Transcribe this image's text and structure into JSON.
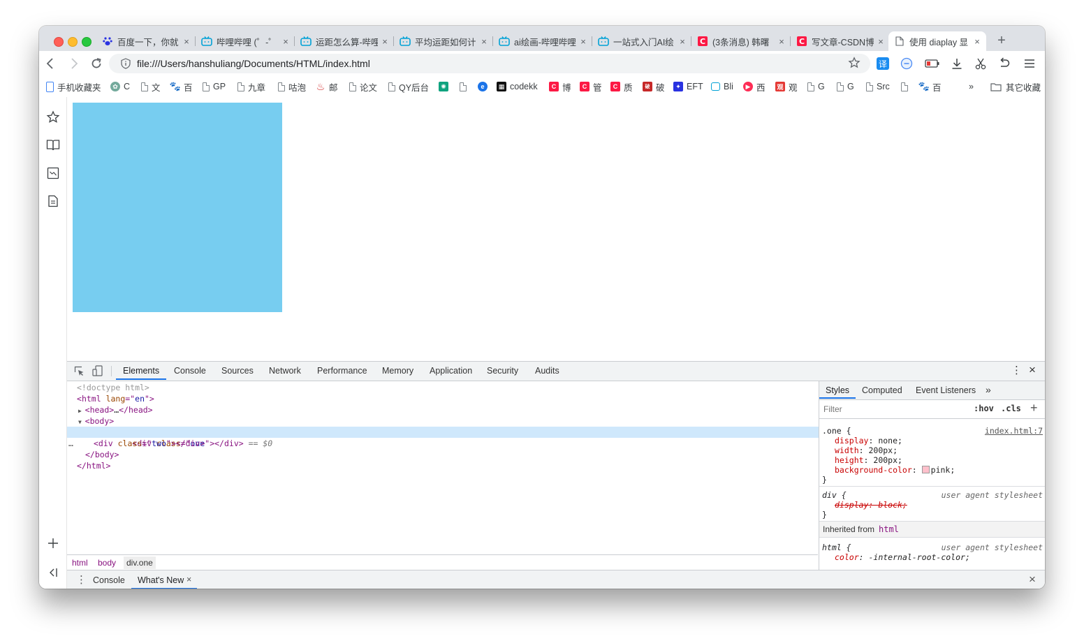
{
  "browser": {
    "tabs": [
      {
        "title": "百度一下，你就",
        "favicon": "baidu-paw",
        "active": false
      },
      {
        "title": "哔哩哔哩 (゜-゜",
        "favicon": "bilibili-tv",
        "active": false
      },
      {
        "title": "运距怎么算-哔哩",
        "favicon": "bilibili-tv",
        "active": false
      },
      {
        "title": "平均运距如何计",
        "favicon": "bilibili-tv",
        "active": false
      },
      {
        "title": "ai绘画-哔哩哔哩",
        "favicon": "bilibili-tv",
        "active": false
      },
      {
        "title": "一站式入门AI绘",
        "favicon": "bilibili-tv",
        "active": false
      },
      {
        "title": "(3条消息) 韩曙",
        "favicon": "csdn-c",
        "active": false
      },
      {
        "title": "写文章-CSDN博",
        "favicon": "csdn-c",
        "active": false
      },
      {
        "title": "使用 diaplay 显",
        "favicon": "file-page",
        "active": true
      }
    ],
    "close_glyph": "×",
    "new_tab_glyph": "+",
    "url": "file:///Users/hanshuliang/Documents/HTML/index.html",
    "translate_label": "译",
    "bookmarks": [
      {
        "label": "手机收藏夹",
        "icon": "phone-icon"
      },
      {
        "label": "C",
        "icon": "chatgpt-icon"
      },
      {
        "label": "文",
        "icon": "page-icon"
      },
      {
        "label": "百",
        "icon": "baidu-icon"
      },
      {
        "label": "GP",
        "icon": "page-icon"
      },
      {
        "label": "九章",
        "icon": "page-icon"
      },
      {
        "label": "咕泡",
        "icon": "page-icon"
      },
      {
        "label": "邮",
        "icon": "mail-icon"
      },
      {
        "label": "论文",
        "icon": "page-icon"
      },
      {
        "label": "QY后台",
        "icon": "page-icon"
      },
      {
        "label": "",
        "icon": "openai-icon"
      },
      {
        "label": "",
        "icon": "page-icon"
      },
      {
        "label": "",
        "icon": "edge-icon"
      },
      {
        "label": "codekk",
        "icon": "grid-icon"
      },
      {
        "label": "博",
        "icon": "csdn-icon"
      },
      {
        "label": "管",
        "icon": "csdn-icon"
      },
      {
        "label": "质",
        "icon": "csdn-icon"
      },
      {
        "label": "破",
        "icon": "red-square-icon"
      },
      {
        "label": "EFT",
        "icon": "baidu-icon"
      },
      {
        "label": "Bli",
        "icon": "bilibili-icon"
      },
      {
        "label": "西",
        "icon": "xigua-icon"
      },
      {
        "label": "观",
        "icon": "guan-icon"
      },
      {
        "label": "G",
        "icon": "page-icon"
      },
      {
        "label": "G",
        "icon": "page-icon"
      },
      {
        "label": "Src",
        "icon": "page-icon"
      },
      {
        "label": "",
        "icon": "page-icon"
      },
      {
        "label": "百",
        "icon": "baidu-icon"
      }
    ],
    "bookmarks_overflow": "»",
    "other_bookmarks": "其它收藏"
  },
  "devtools": {
    "tabs": [
      "Elements",
      "Console",
      "Sources",
      "Network",
      "Performance",
      "Memory",
      "Application",
      "Security",
      "Audits"
    ],
    "more_glyph": "⋮",
    "close_glyph": "×",
    "dom": {
      "doctype": "<!doctype html>",
      "html_open_tag": "html",
      "html_attr": "lang",
      "html_attr_val": "en",
      "head_collapsed": "…",
      "body_tag": "body",
      "div1_class": "one",
      "div2_class": "two",
      "selected_marker": "== $0",
      "ellipsis": "…"
    },
    "breadcrumbs": [
      "html",
      "body",
      "div.one"
    ],
    "styles": {
      "tabs": [
        "Styles",
        "Computed",
        "Event Listeners"
      ],
      "tabs_more": "»",
      "filter_placeholder": "Filter",
      "hov": ":hov",
      "cls": ".cls",
      "add": "+",
      "rule1": {
        "selector": ".one",
        "source": "index.html:7",
        "props": [
          {
            "name": "display",
            "value": "none"
          },
          {
            "name": "width",
            "value": "200px"
          },
          {
            "name": "height",
            "value": "200px"
          },
          {
            "name": "background-color",
            "value": "pink"
          }
        ]
      },
      "swatch_color": "#ffc0cb",
      "rule2": {
        "selector": "div",
        "source": "user agent stylesheet",
        "prop": "display: block;"
      },
      "inherited_label": "Inherited from",
      "inherited_tag": "html",
      "rule3": {
        "selector": "html",
        "source": "user agent stylesheet",
        "prop_name": "color",
        "prop_value": "-internal-root-color"
      }
    },
    "drawer": {
      "tabs": [
        "Console",
        "What's New"
      ],
      "close_glyph": "×"
    }
  },
  "colors": {
    "box_two": "#77cdf0",
    "accent": "#1a73e8"
  }
}
